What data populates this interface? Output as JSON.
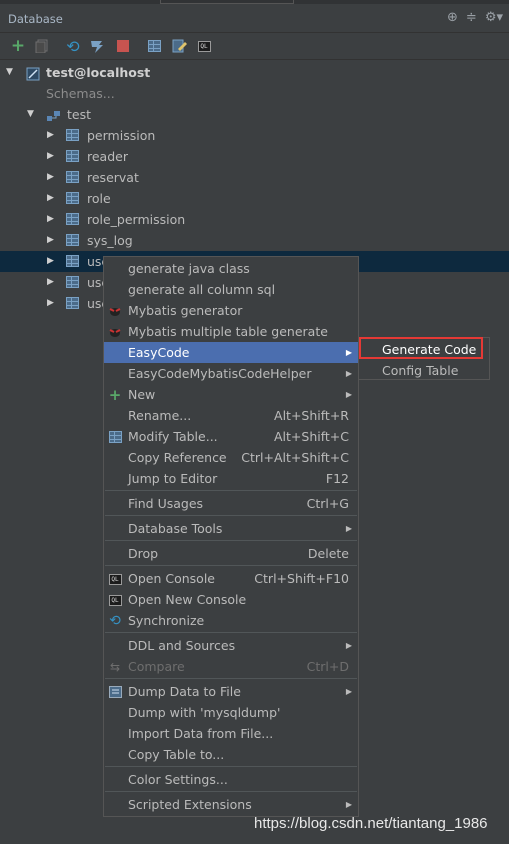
{
  "panel": {
    "title": "Database",
    "title_icons": [
      "crosshair-icon",
      "split-icon",
      "gear-icon"
    ]
  },
  "toolbar": {
    "icons": [
      "add-icon",
      "copy-icon",
      "refresh-icon",
      "properties-icon",
      "stop-icon",
      "table-icon",
      "edit-icon",
      "console-icon"
    ],
    "accent_colors": {
      "add": "#59a869",
      "refresh": "#3592c4",
      "stop": "#c75450"
    }
  },
  "tree": {
    "connection": "test@localhost",
    "schemas_label": "Schemas...",
    "schema": "test",
    "tables": [
      "permission",
      "reader",
      "reservat",
      "role",
      "role_permission",
      "sys_log"
    ],
    "partial_rows": [
      "use",
      "use",
      "use"
    ]
  },
  "context_menu": {
    "items": [
      {
        "label": "generate java class",
        "shortcut": ""
      },
      {
        "label": "generate all column sql",
        "shortcut": ""
      },
      {
        "label": "Mybatis generator",
        "shortcut": ""
      },
      {
        "label": "Mybatis multiple table generate",
        "shortcut": ""
      },
      {
        "label": "EasyCode",
        "shortcut": ""
      },
      {
        "label": "EasyCodeMybatisCodeHelper",
        "shortcut": ""
      },
      {
        "label": "New",
        "shortcut": ""
      },
      {
        "label": "Rename...",
        "shortcut": "Alt+Shift+R"
      },
      {
        "label": "Modify Table...",
        "shortcut": "Alt+Shift+C"
      },
      {
        "label": "Copy Reference",
        "shortcut": "Ctrl+Alt+Shift+C"
      },
      {
        "label": "Jump to Editor",
        "shortcut": "F12"
      },
      {
        "label": "Find Usages",
        "shortcut": "Ctrl+G"
      },
      {
        "label": "Database Tools",
        "shortcut": ""
      },
      {
        "label": "Drop",
        "shortcut": "Delete"
      },
      {
        "label": "Open Console",
        "shortcut": "Ctrl+Shift+F10"
      },
      {
        "label": "Open New Console",
        "shortcut": ""
      },
      {
        "label": "Synchronize",
        "shortcut": ""
      },
      {
        "label": "DDL and Sources",
        "shortcut": ""
      },
      {
        "label": "Compare",
        "shortcut": "Ctrl+D"
      },
      {
        "label": "Dump Data to File",
        "shortcut": ""
      },
      {
        "label": "Dump with 'mysqldump'",
        "shortcut": ""
      },
      {
        "label": "Import Data from File...",
        "shortcut": ""
      },
      {
        "label": "Copy Table to...",
        "shortcut": ""
      },
      {
        "label": "Color Settings...",
        "shortcut": ""
      },
      {
        "label": "Scripted Extensions",
        "shortcut": ""
      }
    ]
  },
  "submenu": {
    "items": [
      {
        "label": "Generate Code"
      },
      {
        "label": "Config Table"
      }
    ]
  },
  "watermark": "https://blog.csdn.net/tiantang_1986",
  "colors": {
    "background": "#3c3f41",
    "highlight": "#4b6eaf",
    "selected_row": "#0d293e",
    "annotation_box": "#e53935"
  }
}
